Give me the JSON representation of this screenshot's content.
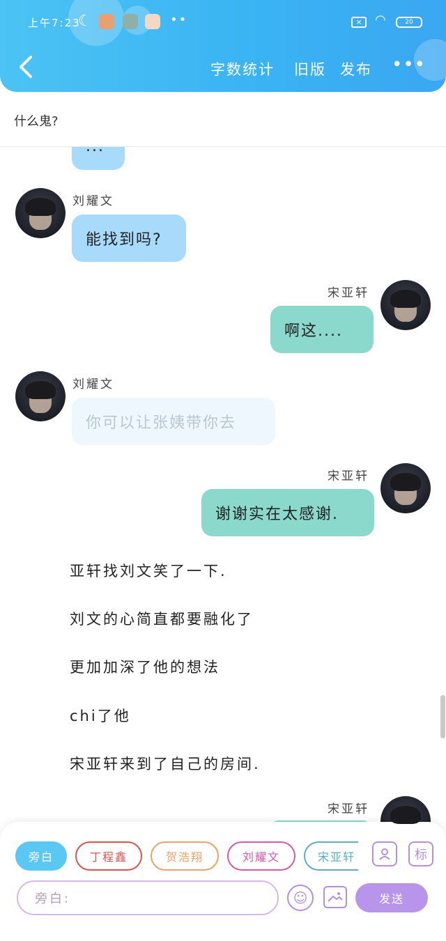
{
  "status_bar": {
    "time": "上午7:23",
    "battery": "20"
  },
  "nav": {
    "word_count": "字数统计",
    "old_version": "旧版",
    "publish": "发布",
    "more": "•••"
  },
  "subtitle": "什么鬼?",
  "messages": [
    {
      "side": "left",
      "text": "..."
    },
    {
      "side": "left",
      "name": "刘耀文",
      "text": "能找到吗?"
    },
    {
      "side": "right",
      "name": "宋亚轩",
      "text": "啊这...."
    },
    {
      "side": "left",
      "name": "刘耀文",
      "text": "你可以让张姨带你去"
    },
    {
      "side": "right",
      "name": "宋亚轩",
      "text": "谢谢实在太感谢."
    },
    {
      "side": "right",
      "name": "宋亚轩",
      "text": ""
    }
  ],
  "narration": [
    "亚轩找刘文笑了一下.",
    "刘文的心简直都要融化了",
    "更加加深了他的想法",
    "chi了他",
    "宋亚轩来到了自己的房间."
  ],
  "composer": {
    "chips": [
      {
        "label": "旁白",
        "color": "#5ac8f2"
      },
      {
        "label": "丁程鑫",
        "color": "#d9534f"
      },
      {
        "label": "贺浩翔",
        "color": "#f0a066"
      },
      {
        "label": "刘耀文",
        "color": "#d65aa8"
      },
      {
        "label": "宋亚轩",
        "color": "#5aaec0"
      }
    ],
    "mark_label": "标",
    "placeholder": "旁白:",
    "send_label": "发送"
  },
  "colors": {
    "header": "#3ab4f3",
    "left_bubble": "#a8dbfb",
    "right_bubble": "#8bd9cd",
    "accent": "#b894ea"
  }
}
